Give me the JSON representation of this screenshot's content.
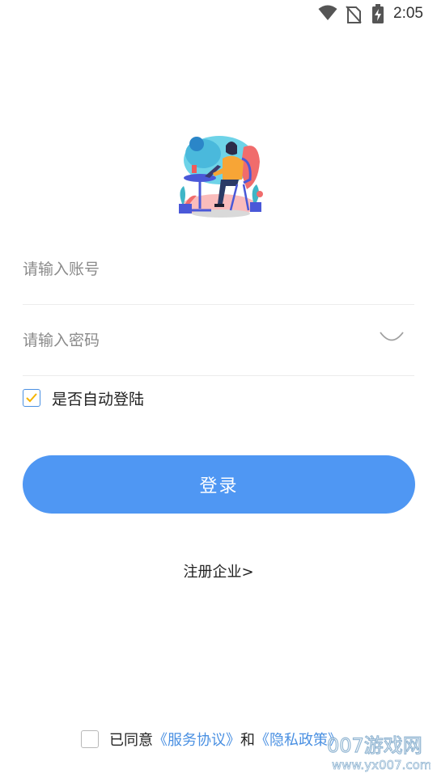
{
  "status_bar": {
    "time": "2:05",
    "icons": [
      "wifi-icon",
      "no-sim-icon",
      "battery-charging-icon"
    ]
  },
  "login_form": {
    "account_placeholder": "请输入账号",
    "password_placeholder": "请输入密码",
    "auto_login_label": "是否自动登陆",
    "auto_login_checked": true,
    "login_button_label": "登录"
  },
  "register": {
    "link_label": "注册企业>"
  },
  "agreement": {
    "prefix": "已同意",
    "service_link": "《服务协议》",
    "conjunction": "和",
    "privacy_link": "《隐私政策》",
    "checked": false
  },
  "watermark": {
    "brand": "007游戏网",
    "url": "www.yx007.com"
  },
  "colors": {
    "accent": "#4f97f3",
    "link": "#4a90e2"
  }
}
